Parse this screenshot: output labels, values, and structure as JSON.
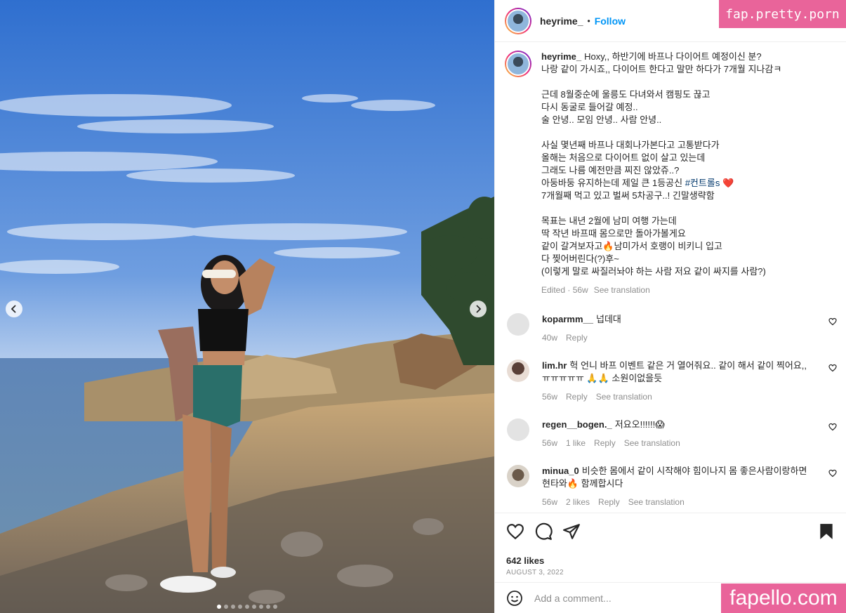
{
  "post": {
    "username": "heyrime_",
    "follow_label": "Follow",
    "separator": "•"
  },
  "caption": {
    "username": "heyrime_",
    "lines": [
      "Hoxy,, 하반기에 바프나 다이어트 예정이신 분?",
      "나랑 같이 가시죠,, 다이어트 한다고 말만 하다가 7개월 지나감ㅋ",
      "",
      "근데 8월중순에 울릉도 다녀와서 캠핑도 끊고",
      "다시 동굴로 들어갈 예정..",
      "술 안녕.. 모임 안녕.. 사람 안녕..",
      "",
      "사실 몇년째 바프나 대회나가본다고 고통받다가",
      "올해는 처음으로 다이어트 없이 살고 있는데",
      "그래도 나름 예전만큼 찌진 않았쥬..?",
      "아둥바둥 유지하는데 제일 큰 1등공신 ",
      "7개월째 먹고 있고 벌써 5차공구..! 긴말생략함",
      "",
      "목표는 내년 2월에 남미 여행 가는데",
      "딱 작년 바프때 몸으로만 돌아가볼게요",
      "같이 갈겨보자고🔥남미가서 호랭이 비키니 입고",
      "다 찢어버린다(?)후~",
      "(이렇게 말로 싸질러놔야 하는 사람 저요 같이 싸지를 사람?)"
    ],
    "hashtag": "#컨트롤s",
    "hashtag_suffix": " ❤️",
    "edited": "Edited · 56w",
    "see_translation": "See translation"
  },
  "comments": [
    {
      "username": "koparmm__",
      "text": "넙데대",
      "age": "40w",
      "likes": "",
      "reply": "Reply",
      "translation": ""
    },
    {
      "username": "lim.hr",
      "text": "헉 언니 바프 이벤트 같은 거 열어줘요.. 같이 해서 같이 찍어요,, ㅠㅠㅠㅠㅠ 🙏🙏 소원이없을듯",
      "age": "56w",
      "likes": "",
      "reply": "Reply",
      "translation": "See translation"
    },
    {
      "username": "regen__bogen._",
      "text": "저요오!!!!!!😱",
      "age": "56w",
      "likes": "1 like",
      "reply": "Reply",
      "translation": "See translation"
    },
    {
      "username": "minua_0",
      "text": "비슷한 몸에서 같이 시작해야 힘이나지 몸 좋은사람이랑하면 현타와🔥 함께합시다",
      "age": "56w",
      "likes": "2 likes",
      "reply": "Reply",
      "translation": "See translation"
    }
  ],
  "likes": "642 likes",
  "date": "AUGUST 3, 2022",
  "add_comment_placeholder": "Add a comment...",
  "watermarks": {
    "top": "fap.pretty.porn",
    "bottom": "fapello.com"
  },
  "icons": [
    "chevron-left-icon",
    "chevron-right-icon",
    "heart-icon",
    "comment-icon",
    "share-icon",
    "bookmark-icon",
    "emoji-icon"
  ],
  "colors": {
    "accent": "#0095f6",
    "hashtag": "#00376b",
    "watermark": "#e9649a",
    "muted": "#8e8e8e"
  },
  "carousel": {
    "slides": 9,
    "current": 1
  }
}
